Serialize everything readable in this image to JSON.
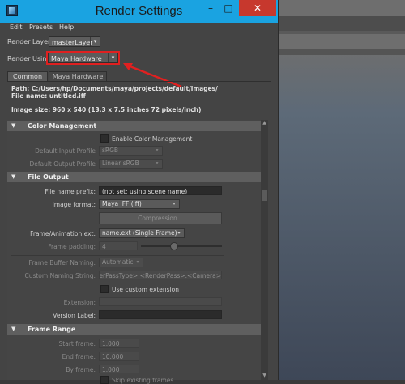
{
  "window": {
    "title": "Render Settings",
    "controls": {
      "minimize": "–",
      "maximize": "□",
      "close": "✕"
    }
  },
  "menu": [
    "Edit",
    "Presets",
    "Help"
  ],
  "render_layer": {
    "label": "Render Layer",
    "value": "masterLayer"
  },
  "render_using": {
    "label": "Render Using",
    "value": "Maya Hardware"
  },
  "tabs": [
    "Common",
    "Maya Hardware"
  ],
  "info": {
    "path": "Path: C:/Users/hp/Documents/maya/projects/default/images/",
    "file_name": "File name:  untitled.iff",
    "image_size": "Image size: 960 x 540 (13.3 x 7.5 inches 72 pixels/inch)"
  },
  "color_management": {
    "title": "Color Management",
    "enable_label": "Enable Color Management",
    "input_profile": {
      "label": "Default Input Profile",
      "value": "sRGB"
    },
    "output_profile": {
      "label": "Default Output Profile",
      "value": "Linear sRGB"
    }
  },
  "file_output": {
    "title": "File Output",
    "prefix": {
      "label": "File name prefix:",
      "value": "(not set; using scene name)"
    },
    "image_format": {
      "label": "Image format:",
      "value": "Maya IFF (iff)"
    },
    "compression_button": "Compression...",
    "frame_ext": {
      "label": "Frame/Animation ext:",
      "value": "name.ext (Single Frame)"
    },
    "frame_padding": {
      "label": "Frame padding:",
      "value": "4",
      "slider_fraction": 0.4
    },
    "buffer_naming": {
      "label": "Frame Buffer Naming:",
      "value": "Automatic"
    },
    "custom_naming": {
      "label": "Custom Naming String:",
      "value": "<RenderPassType>:<RenderPass>.<Camera>"
    },
    "custom_extension_check": "Use custom extension",
    "extension": {
      "label": "Extension:",
      "value": ""
    },
    "version_label": {
      "label": "Version Label:",
      "value": ""
    }
  },
  "frame_range": {
    "title": "Frame Range",
    "start": {
      "label": "Start frame:",
      "value": "1.000"
    },
    "end": {
      "label": "End frame:",
      "value": "10.000"
    },
    "by": {
      "label": "By frame:",
      "value": "1.000"
    },
    "skip_existing": "Skip existing frames"
  },
  "colors": {
    "titlebar": "#1aa3e1",
    "close": "#c7382d",
    "highlight": "#e02020"
  }
}
